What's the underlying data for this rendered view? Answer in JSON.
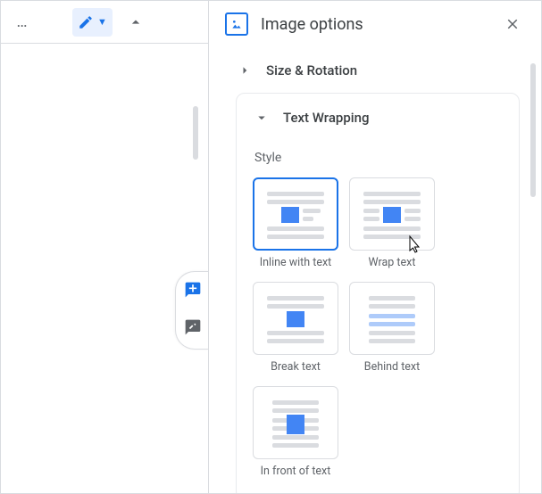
{
  "panel": {
    "title": "Image options",
    "sections": {
      "sizeRotation": {
        "title": "Size & Rotation"
      },
      "textWrapping": {
        "title": "Text Wrapping",
        "styleLabel": "Style",
        "options": {
          "inline": {
            "label": "Inline with text"
          },
          "wrap": {
            "label": "Wrap text"
          },
          "break": {
            "label": "Break text"
          },
          "behind": {
            "label": "Behind text"
          },
          "front": {
            "label": "In front of text"
          }
        }
      }
    }
  }
}
